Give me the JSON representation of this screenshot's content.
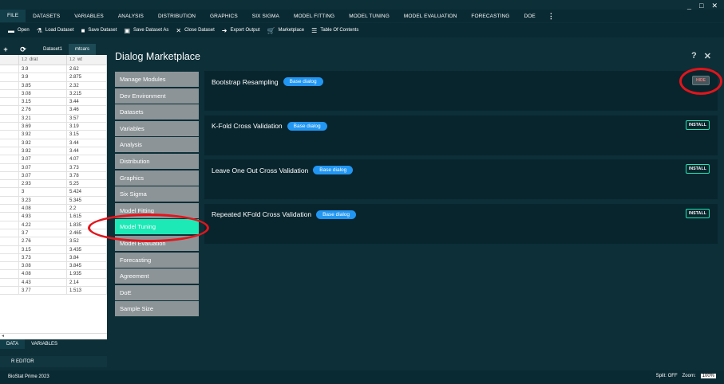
{
  "window": {
    "min": "_",
    "max": "□",
    "close": "✕"
  },
  "menu": [
    "FILE",
    "DATASETS",
    "VARIABLES",
    "ANALYSIS",
    "DISTRIBUTION",
    "GRAPHICS",
    "SIX SIGMA",
    "MODEL FITTING",
    "MODEL TUNING",
    "MODEL EVALUATION",
    "FORECASTING",
    "DOE"
  ],
  "menu_more": "⋮",
  "toolbar": [
    "Open",
    "Load Dataset",
    "Save Dataset",
    "Save Dataset As",
    "Close Dataset",
    "Export Output",
    "Marketplace",
    "Table Of Contents"
  ],
  "left_panel": {
    "add": "+",
    "refresh": "⟳",
    "tabs": [
      "Dataset1",
      "mtcars"
    ],
    "columns": [
      "drat",
      "wt"
    ],
    "rows": [
      [
        "3.9",
        "2.62"
      ],
      [
        "3.9",
        "2.875"
      ],
      [
        "3.85",
        "2.32"
      ],
      [
        "3.08",
        "3.215"
      ],
      [
        "3.15",
        "3.44"
      ],
      [
        "2.76",
        "3.46"
      ],
      [
        "3.21",
        "3.57"
      ],
      [
        "3.69",
        "3.19"
      ],
      [
        "3.92",
        "3.15"
      ],
      [
        "3.92",
        "3.44"
      ],
      [
        "3.92",
        "3.44"
      ],
      [
        "3.07",
        "4.07"
      ],
      [
        "3.07",
        "3.73"
      ],
      [
        "3.07",
        "3.78"
      ],
      [
        "2.93",
        "5.25"
      ],
      [
        "3",
        "5.424"
      ],
      [
        "3.23",
        "5.345"
      ],
      [
        "4.08",
        "2.2"
      ],
      [
        "4.93",
        "1.615"
      ],
      [
        "4.22",
        "1.835"
      ],
      [
        "3.7",
        "2.465"
      ],
      [
        "2.76",
        "3.52"
      ],
      [
        "3.15",
        "3.435"
      ],
      [
        "3.73",
        "3.84"
      ],
      [
        "3.08",
        "3.845"
      ],
      [
        "4.08",
        "1.935"
      ],
      [
        "4.43",
        "2.14"
      ],
      [
        "3.77",
        "1.513"
      ]
    ],
    "scroll_left": "◂"
  },
  "bottom_tabs": [
    "DATA",
    "VARIABLES"
  ],
  "r_editor": "R EDITOR",
  "status": {
    "app": "BioStat Prime 2023",
    "split": "Split: OFF",
    "zoom_label": "Zoom:",
    "zoom": "100%"
  },
  "dialog": {
    "title": "Dialog Marketplace",
    "help": "?",
    "close": "✕",
    "nav": [
      "Manage Modules",
      "Dev Environment",
      "Datasets",
      "Variables",
      "Analysis",
      "Distribution",
      "Graphics",
      "Six Sigma",
      "Model Fitting",
      "Model Tuning",
      "Model Evaluation",
      "Forecasting",
      "Agreement",
      "DoE",
      "Sample Size"
    ],
    "selected_nav": "Model Tuning",
    "cards": [
      {
        "title": "Bootstrap Resampling",
        "badge": "Base dialog",
        "action": "HIDE"
      },
      {
        "title": "K-Fold Cross Validation",
        "badge": "Base dialog",
        "action": "INSTALL"
      },
      {
        "title": "Leave One Out Cross Validation",
        "badge": "Base dialog",
        "action": "INSTALL"
      },
      {
        "title": "Repeated KFold Cross Validation",
        "badge": "Base dialog",
        "action": "INSTALL"
      }
    ]
  },
  "colors": {
    "accent": "#1de9b6",
    "badge": "#2196f3",
    "highlight_ring": "#e3141b"
  }
}
